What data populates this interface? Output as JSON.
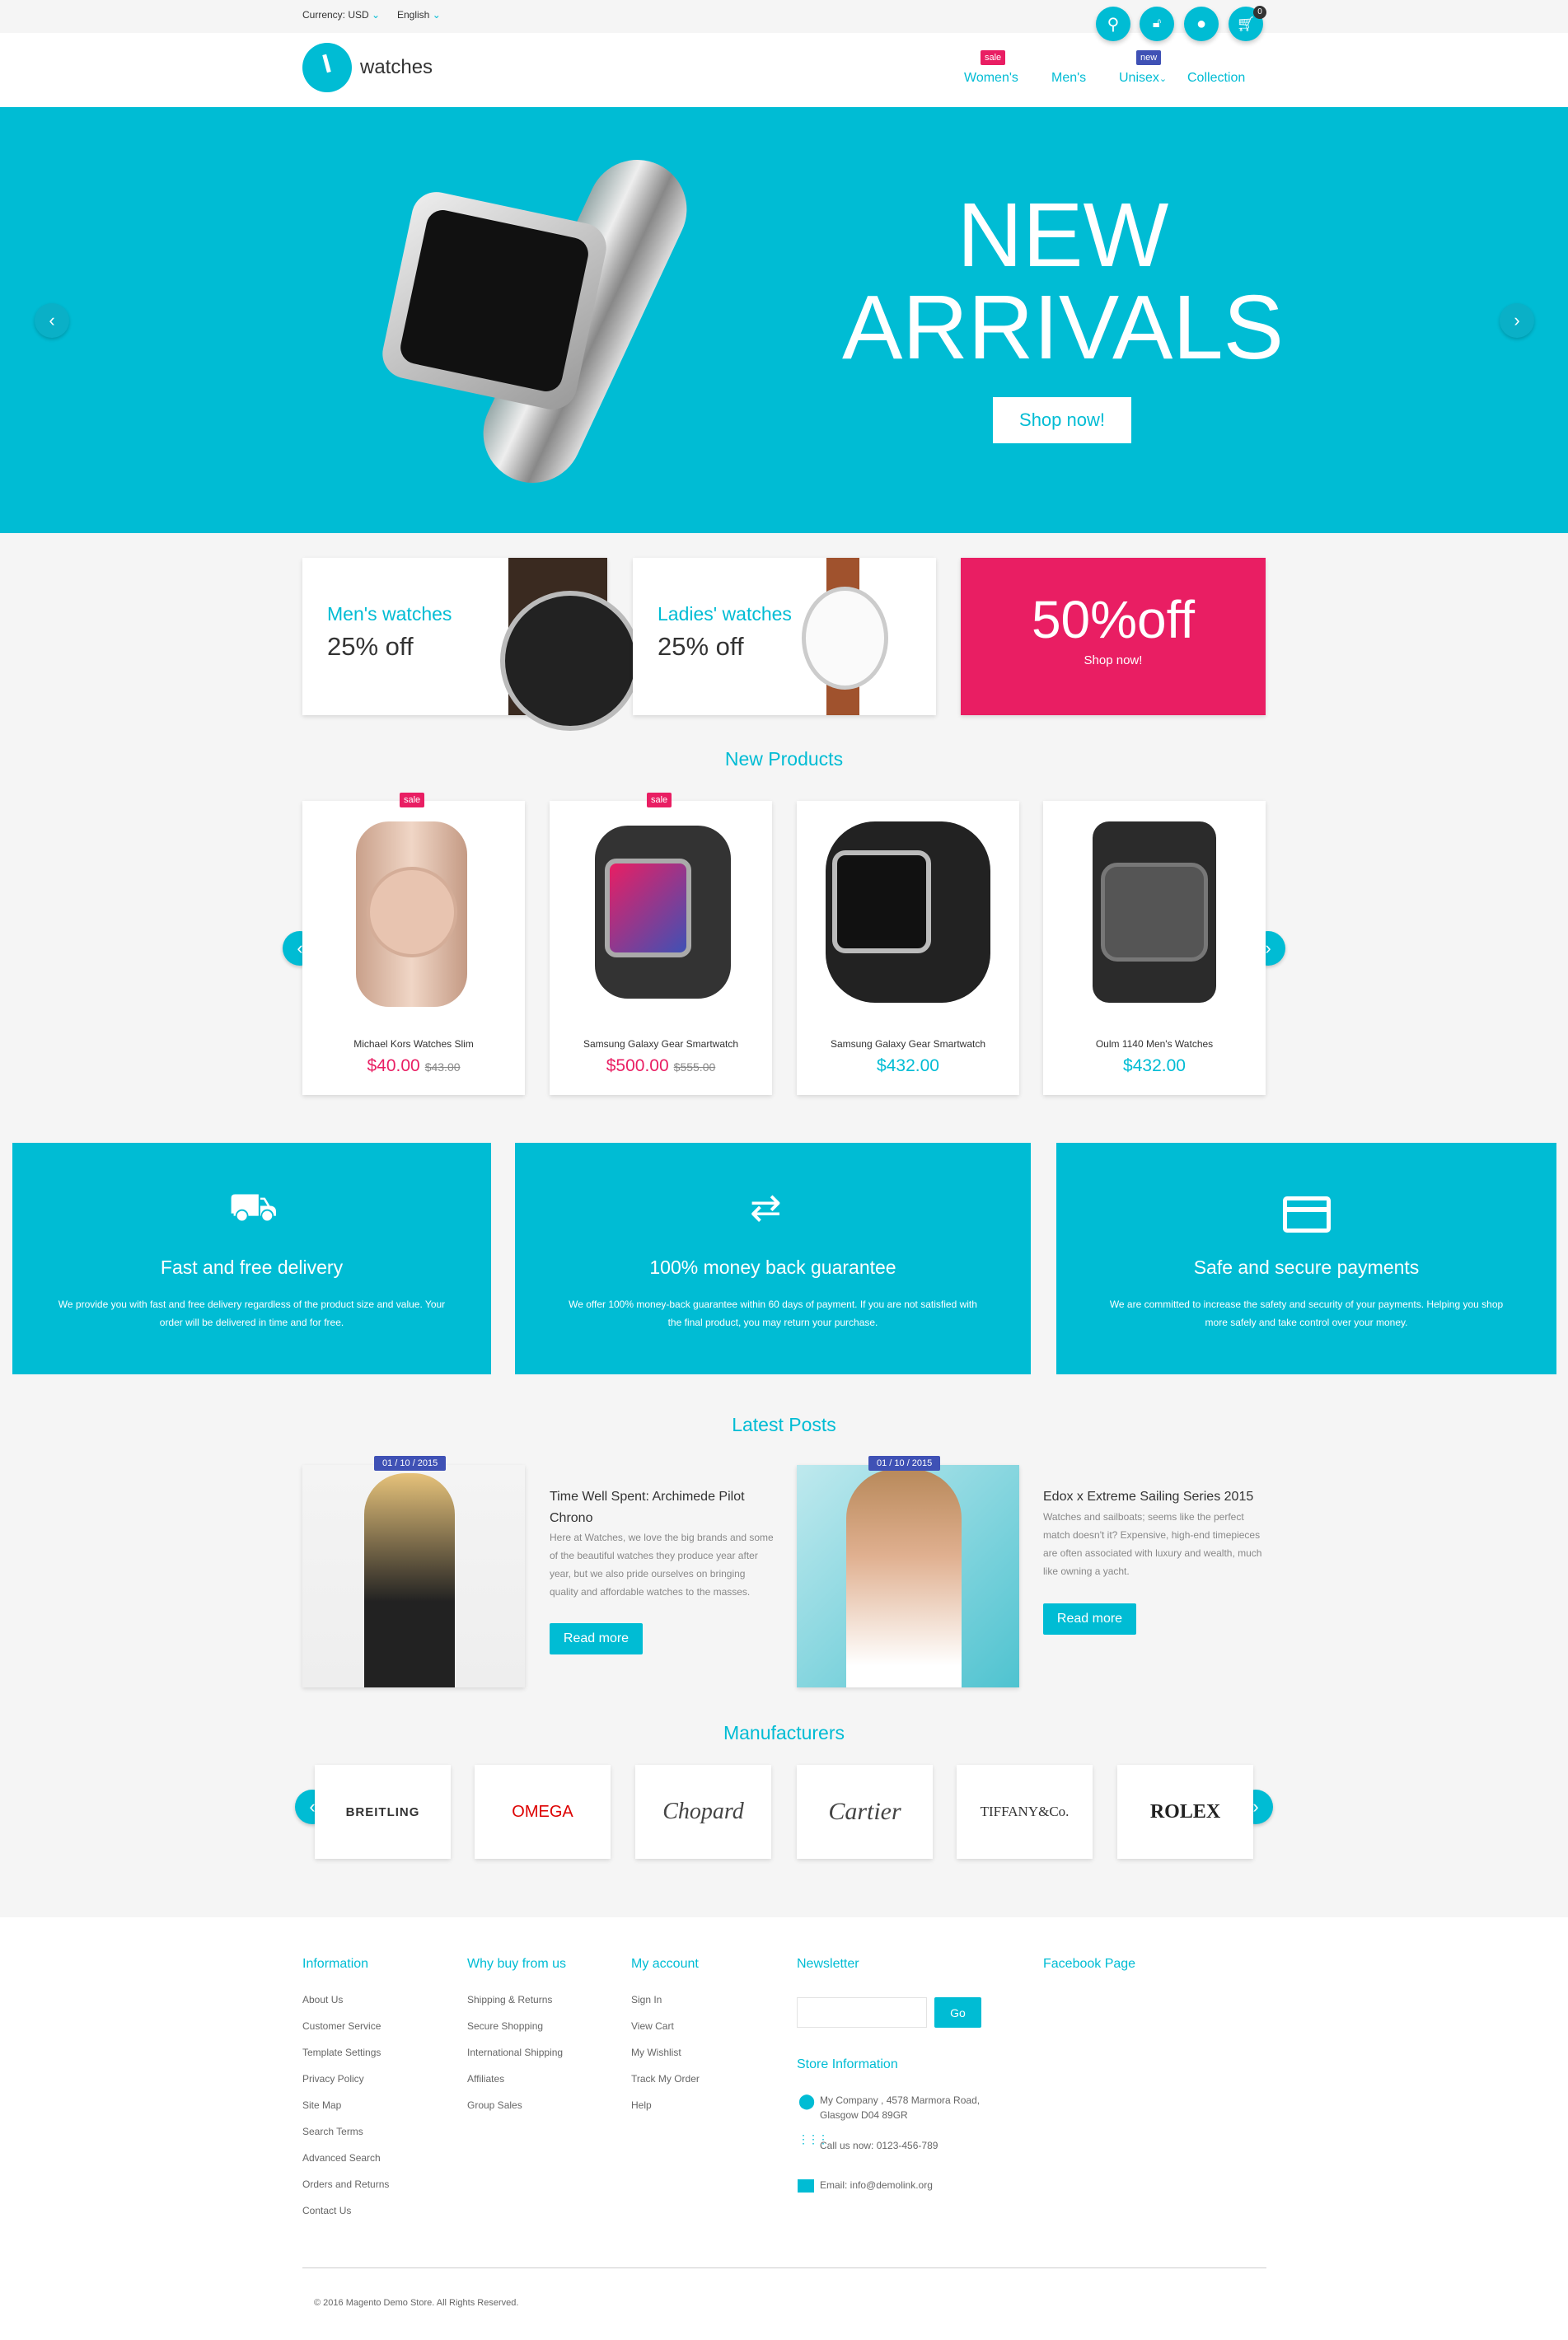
{
  "topbar": {
    "currency": "Currency: USD",
    "language": "English",
    "cart_count": "0"
  },
  "header": {
    "logo": "watches",
    "nav": [
      {
        "label": "Women's",
        "badge": "sale"
      },
      {
        "label": "Men's"
      },
      {
        "label": "Unisex",
        "badge": "new"
      },
      {
        "label": "Collection"
      }
    ]
  },
  "hero": {
    "line1": "NEW",
    "line2": "ARRIVALS",
    "cta": "Shop now!"
  },
  "promos": [
    {
      "title": "Men's watches",
      "sub": "25% off"
    },
    {
      "title": "Ladies' watches",
      "sub": "25% off"
    },
    {
      "title": "50%off",
      "sub": "Shop now!"
    }
  ],
  "new_products": {
    "title": "New Products",
    "items": [
      {
        "name": "Michael Kors Watches Slim",
        "price": "$40.00",
        "old": "$43.00",
        "badge": "sale"
      },
      {
        "name": "Samsung Galaxy Gear Smartwatch",
        "price": "$500.00",
        "old": "$555.00",
        "badge": "sale"
      },
      {
        "name": "Samsung Galaxy Gear Smartwatch",
        "price": "$432.00"
      },
      {
        "name": "Oulm 1140 Men's Watches",
        "price": "$432.00"
      }
    ]
  },
  "features": [
    {
      "icon": "delivery-truck-icon",
      "title": "Fast and free delivery",
      "text": "We provide you with fast and free delivery regardless of the product size and value. Your order will be delivered in time and for free."
    },
    {
      "icon": "exchange-arrows-icon",
      "title": "100% money back guarantee",
      "text": "We offer 100% money-back guarantee within 60 days of payment. If you are not satisfied with the final product, you may return your purchase."
    },
    {
      "icon": "credit-card-icon",
      "title": "Safe and secure payments",
      "text": "We are committed to increase the safety and security of your payments. Helping you shop more safely and take control over your money."
    }
  ],
  "posts": {
    "title": "Latest Posts",
    "items": [
      {
        "date": "01 / 10 / 2015",
        "title": "Time Well Spent: Archimede Pilot Chrono",
        "text": "Here at Watches, we love the big brands and some of the beautiful watches they produce year after year, but we also pride ourselves on bringing quality and affordable watches to the masses.",
        "cta": "Read more"
      },
      {
        "date": "01 / 10 / 2015",
        "title": "Edox x Extreme Sailing Series 2015",
        "text": "Watches and sailboats; seems like the perfect match doesn't it? Expensive, high-end timepieces are often associated with luxury and wealth, much like owning a yacht.",
        "cta": "Read more"
      }
    ]
  },
  "manufacturers": {
    "title": "Manufacturers",
    "brands": [
      "BREITLING",
      "OMEGA",
      "Chopard",
      "Cartier",
      "TIFFANY&Co.",
      "ROLEX"
    ]
  },
  "footer": {
    "information": {
      "title": "Information",
      "links": [
        "About Us",
        "Customer Service",
        "Template Settings",
        "Privacy Policy",
        "Site Map",
        "Search Terms",
        "Advanced Search",
        "Orders and Returns",
        "Contact Us"
      ]
    },
    "why": {
      "title": "Why buy from us",
      "links": [
        "Shipping & Returns",
        "Secure Shopping",
        "International Shipping",
        "Affiliates",
        "Group Sales"
      ]
    },
    "account": {
      "title": "My account",
      "links": [
        "Sign In",
        "View Cart",
        "My Wishlist",
        "Track My Order",
        "Help"
      ]
    },
    "newsletter": {
      "title": "Newsletter",
      "button": "Go",
      "placeholder": ""
    },
    "facebook": {
      "title": "Facebook Page"
    },
    "store": {
      "title": "Store Information",
      "address": "My Company , 4578 Marmora Road, Glasgow D04 89GR",
      "phone": "Call us now: 0123-456-789",
      "email": "Email: info@demolink.org"
    },
    "copyright": "© 2016 Magento Demo Store. All Rights Reserved."
  },
  "colors": {
    "accent": "#00bcd4",
    "sale": "#e91e63",
    "new": "#3f51b5"
  }
}
